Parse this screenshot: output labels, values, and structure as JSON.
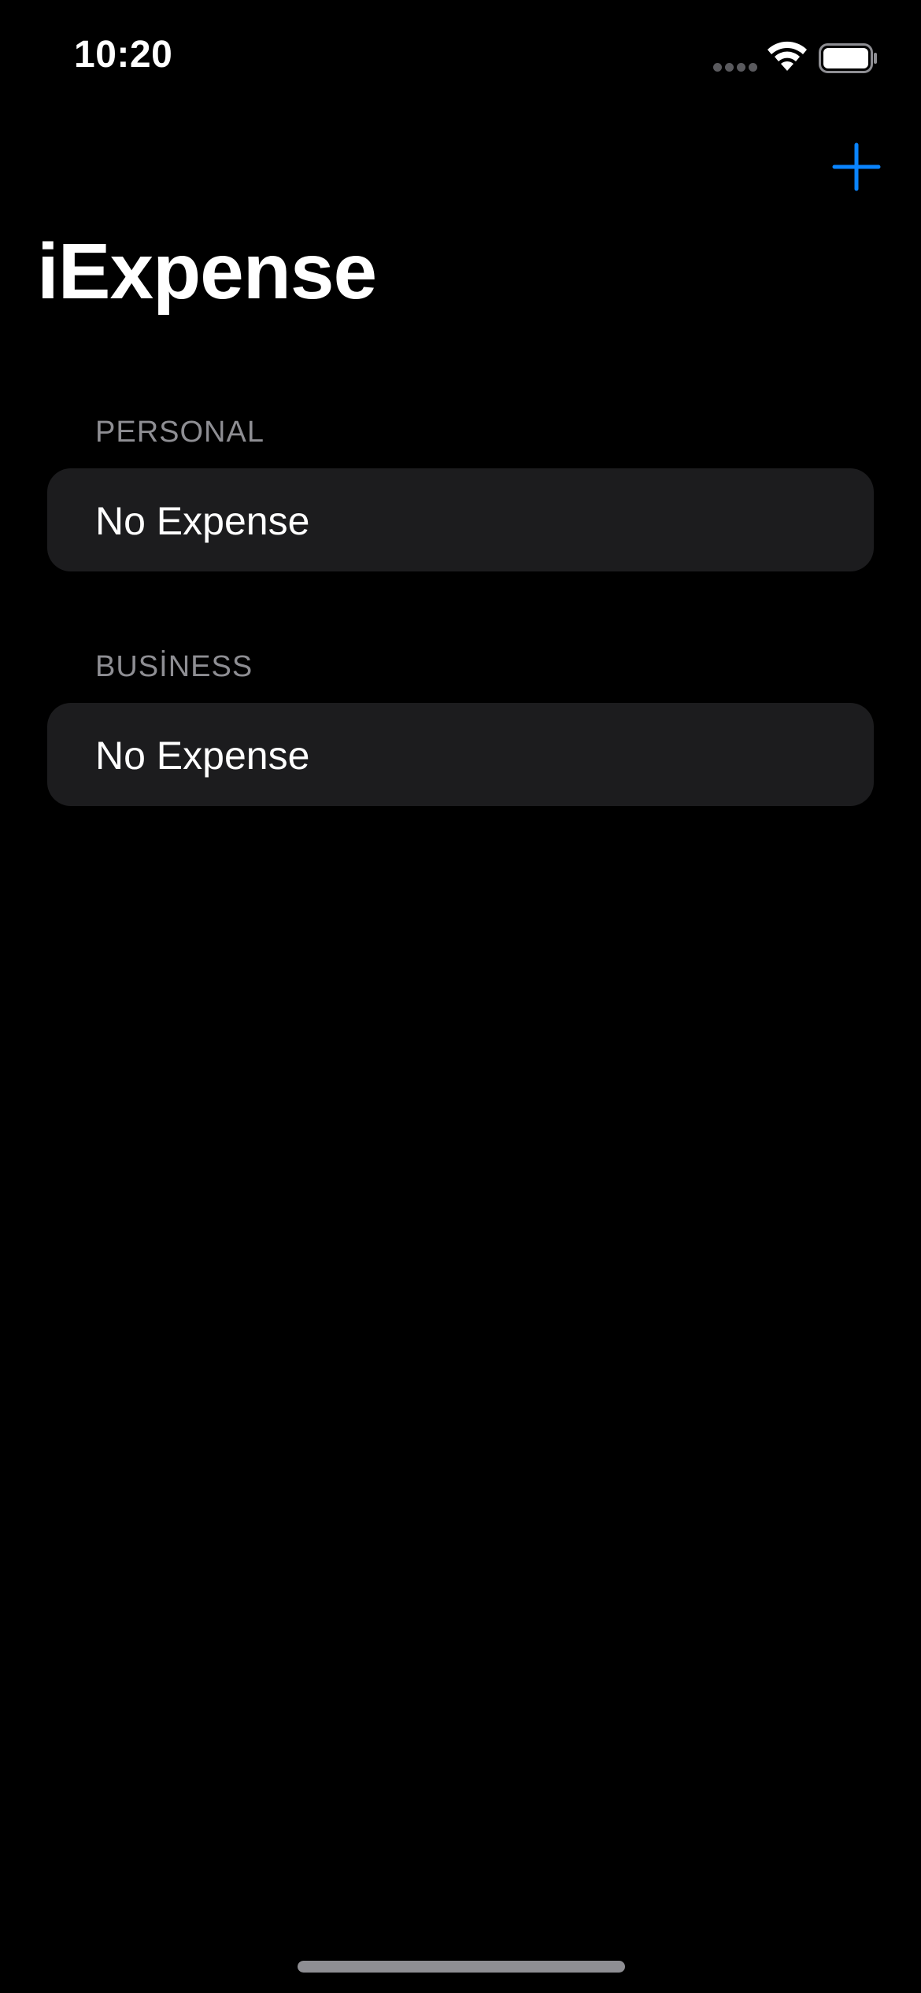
{
  "status_bar": {
    "time": "10:20"
  },
  "nav": {
    "title": "iExpense",
    "add_icon": "plus-icon"
  },
  "sections": [
    {
      "header": "PERSONAL",
      "row_label": "No Expense"
    },
    {
      "header": "BUSİNESS",
      "row_label": "No Expense"
    }
  ],
  "colors": {
    "accent": "#0a84ff",
    "background": "#000000",
    "card": "#1c1c1e",
    "secondary_text": "#8e8e93"
  }
}
